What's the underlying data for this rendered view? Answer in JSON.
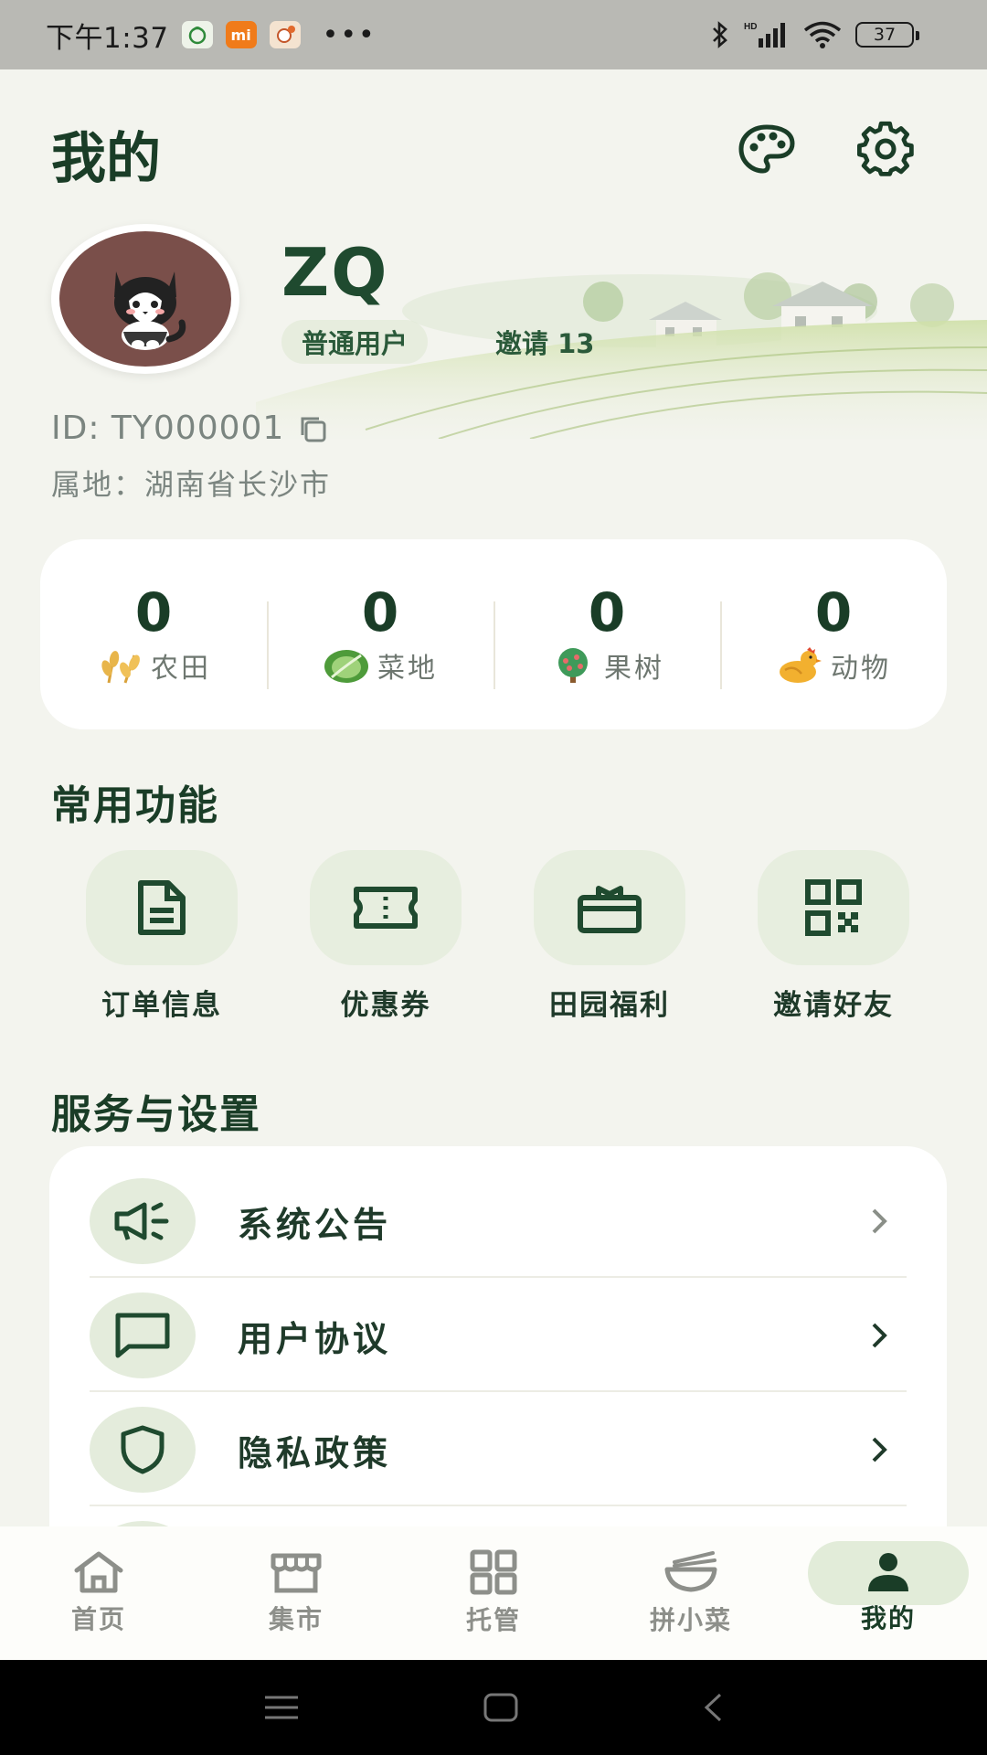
{
  "status_bar": {
    "time": "下午1:37",
    "app_icon_b": "mi",
    "more": "•••",
    "battery": "37"
  },
  "header": {
    "title": "我的"
  },
  "profile": {
    "username": "ZQ",
    "user_type": "普通用户",
    "invite_label": "邀请 13",
    "id_text": "ID: TY000001",
    "location_text": "属地：湖南省长沙市"
  },
  "stats": [
    {
      "value": "0",
      "label": "农田",
      "icon": "wheat-icon"
    },
    {
      "value": "0",
      "label": "菜地",
      "icon": "cabbage-icon"
    },
    {
      "value": "0",
      "label": "果树",
      "icon": "fruit-tree-icon"
    },
    {
      "value": "0",
      "label": "动物",
      "icon": "chicken-icon"
    }
  ],
  "sections": {
    "common_title": "常用功能",
    "services_title": "服务与设置"
  },
  "features": [
    {
      "label": "订单信息",
      "icon": "document-icon"
    },
    {
      "label": "优惠券",
      "icon": "ticket-icon"
    },
    {
      "label": "田园福利",
      "icon": "gift-box-icon"
    },
    {
      "label": "邀请好友",
      "icon": "qr-code-icon"
    }
  ],
  "settings": [
    {
      "label": "系统公告",
      "icon": "megaphone-icon"
    },
    {
      "label": "用户协议",
      "icon": "chat-bubble-icon"
    },
    {
      "label": "隐私政策",
      "icon": "shield-icon"
    }
  ],
  "bottom_nav": [
    {
      "label": "首页",
      "icon": "home-icon"
    },
    {
      "label": "集市",
      "icon": "store-icon"
    },
    {
      "label": "托管",
      "icon": "grid-icon"
    },
    {
      "label": "拼小菜",
      "icon": "bowl-icon"
    },
    {
      "label": "我的",
      "icon": "person-icon",
      "active": true
    }
  ],
  "colors": {
    "primary": "#1a3d27",
    "tile": "#e7eedf",
    "background": "#f3f4ee"
  }
}
